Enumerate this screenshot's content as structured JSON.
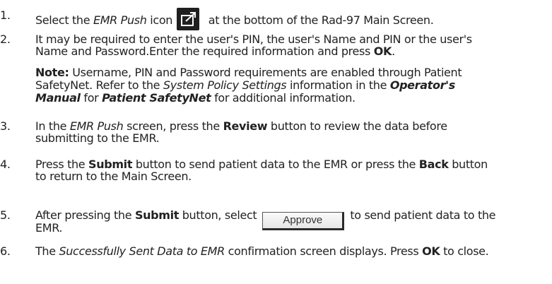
{
  "steps": [
    {
      "num": "1.",
      "p1": "Select the ",
      "p2": "EMR Push",
      "p3": " icon",
      "p4": " at the bottom of the Rad-97 Main Screen."
    },
    {
      "num": "2.",
      "line1": "It may be required to enter the user's PIN, the user's Name and PIN or the user's",
      "line2a": "Name and Password.Enter the required information and press ",
      "line2b": "OK",
      "line2c": "."
    },
    {
      "num": "3.",
      "line1a": "In the ",
      "line1b": "EMR Push",
      "line1c": " screen, press the ",
      "line1d": "Review",
      "line1e": " button to review the data before",
      "line2": "submitting to the EMR."
    },
    {
      "num": "4.",
      "line1a": "Press the ",
      "line1b": "Submit",
      "line1c": " button to send patient data to the EMR or press the ",
      "line1d": "Back",
      "line1e": " button",
      "line2": "to return to the Main Screen."
    },
    {
      "num": "5.",
      "line1a": "After pressing the ",
      "line1b": "Submit",
      "line1c": " button, select",
      "button": "Approve",
      "line1d": "to send patient data to the",
      "line2": "EMR."
    },
    {
      "num": "6.",
      "a": "The ",
      "b": "Successfully Sent Data to EMR",
      "c": " confirmation screen displays. Press ",
      "d": "OK",
      "e": " to close."
    }
  ],
  "note": {
    "label": "Note:",
    "l1": " Username, PIN and Password requirements are enabled through Patient",
    "l2a": "SafetyNet. Refer to the ",
    "l2b": "System Policy Settings",
    "l2c": " information in the ",
    "l2d": "Operator's",
    "l3a": "Manual",
    "l3b": " for ",
    "l3c": "Patient SafetyNet",
    "l3d": " for additional information."
  },
  "icons": {
    "emr_push": "emr-push-icon"
  }
}
